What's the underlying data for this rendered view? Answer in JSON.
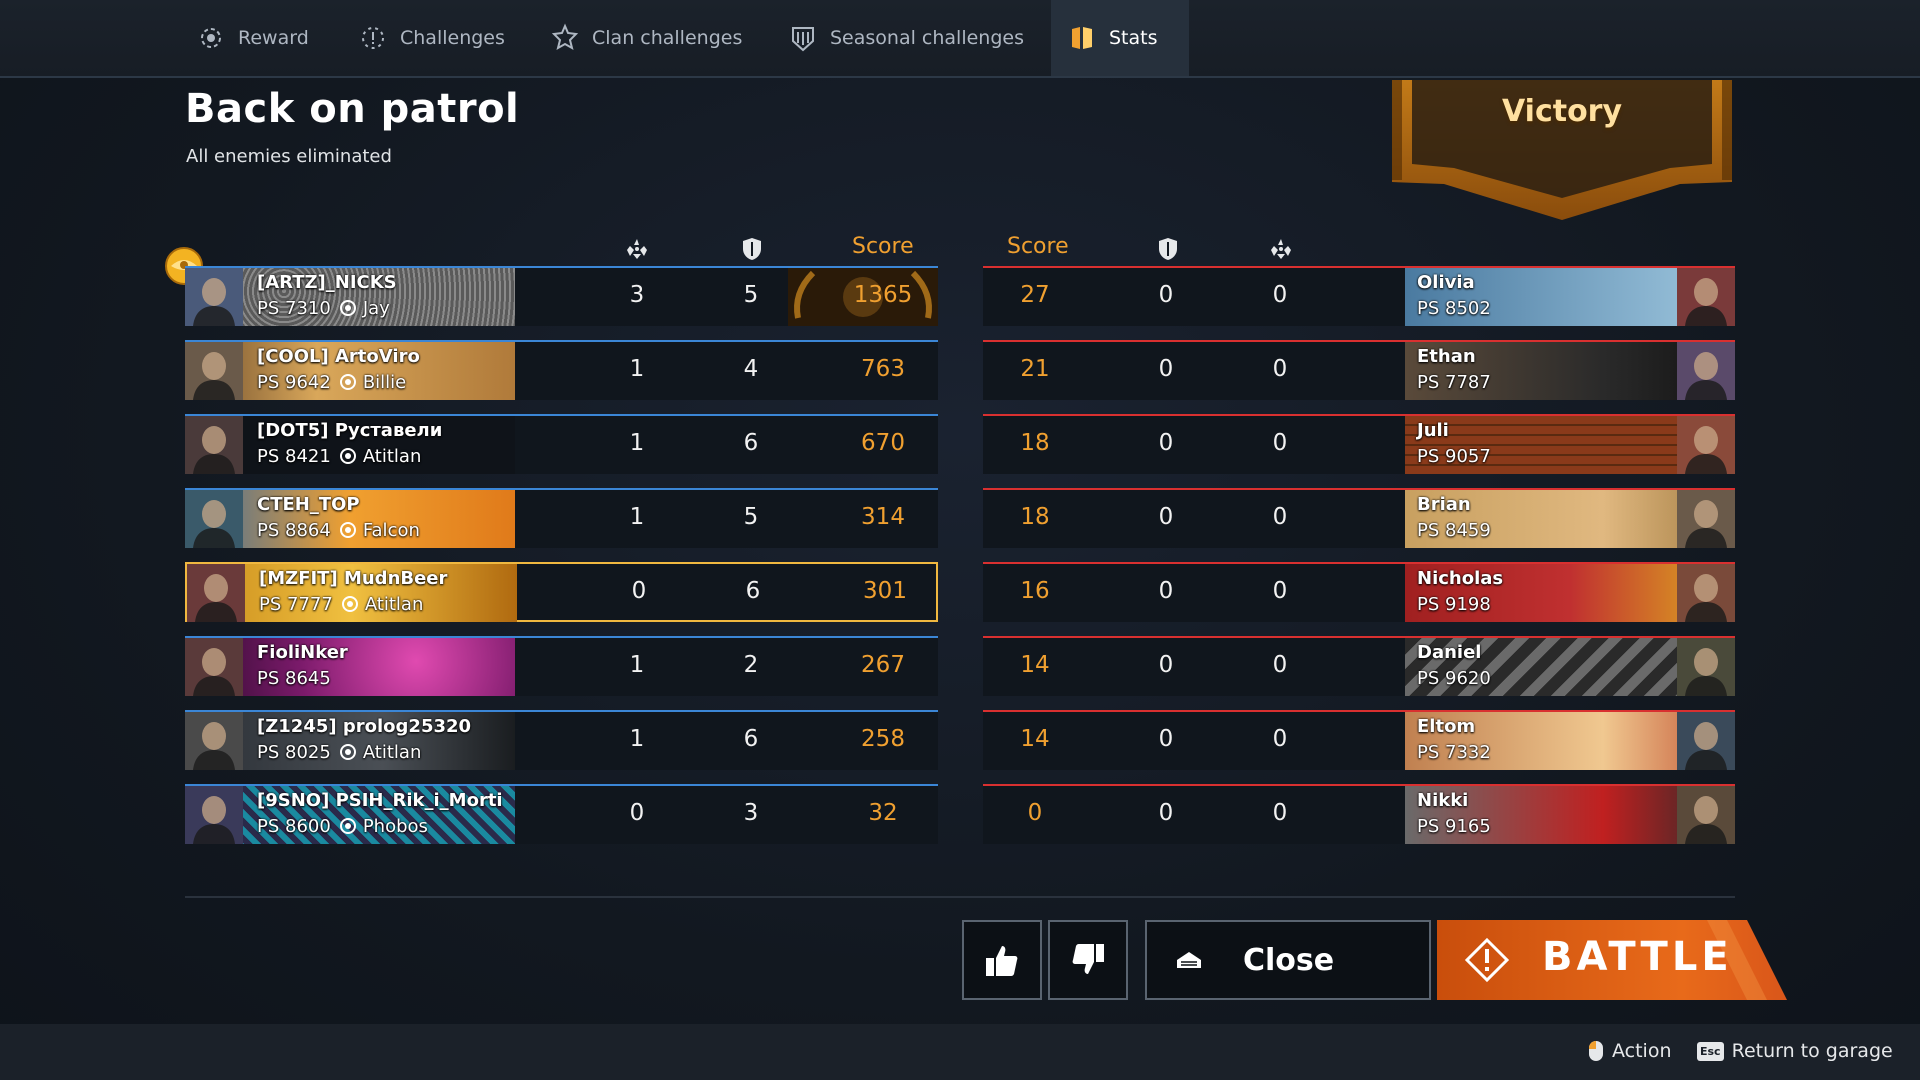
{
  "tabs": [
    {
      "label": "Reward",
      "icon": "reward-icon"
    },
    {
      "label": "Challenges",
      "icon": "challenges-icon"
    },
    {
      "label": "Clan challenges",
      "icon": "clan-challenges-icon"
    },
    {
      "label": "Seasonal challenges",
      "icon": "seasonal-challenges-icon"
    },
    {
      "label": "Stats",
      "icon": "stats-icon",
      "active": true
    }
  ],
  "header": {
    "title": "Back on patrol",
    "subtitle": "All enemies eliminated",
    "result": "Victory"
  },
  "columns": {
    "score_left": "Score",
    "score_right": "Score"
  },
  "team_left": [
    {
      "name": "[ARTZ]_NICKS",
      "ps": "PS 7310",
      "clan_icon": "crosshair-icon",
      "clan": "Jay",
      "kills": "3",
      "assists": "5",
      "score": "1365",
      "top": true
    },
    {
      "name": "[COOL] ArtoViro",
      "ps": "PS 9642",
      "clan_icon": "grid-badge-icon",
      "clan": "Billie",
      "kills": "1",
      "assists": "4",
      "score": "763"
    },
    {
      "name": "[DOT5] Руставели",
      "ps": "PS 8421",
      "clan_icon": "gear-icon",
      "clan": "Atitlan",
      "kills": "1",
      "assists": "6",
      "score": "670"
    },
    {
      "name": "CTEH_TOP",
      "ps": "PS 8864",
      "clan_icon": "ring-icon",
      "clan": "Falcon",
      "kills": "1",
      "assists": "5",
      "score": "314"
    },
    {
      "name": "[MZFIT] MudnBeer",
      "ps": "PS 7777",
      "clan_icon": "gear-icon",
      "clan": "Atitlan",
      "kills": "0",
      "assists": "6",
      "score": "301",
      "me": true
    },
    {
      "name": "FioliNker",
      "ps": "PS 8645",
      "clan_icon": "",
      "clan": "",
      "kills": "1",
      "assists": "2",
      "score": "267"
    },
    {
      "name": "[Z1245] prolog25320",
      "ps": "PS 8025",
      "clan_icon": "gear-icon",
      "clan": "Atitlan",
      "kills": "1",
      "assists": "6",
      "score": "258"
    },
    {
      "name": "[9SNO] PSIH_Rik_i_Morti",
      "ps": "PS 8600",
      "clan_icon": "mask-icon",
      "clan": "Phobos",
      "kills": "0",
      "assists": "3",
      "score": "32"
    }
  ],
  "team_right": [
    {
      "name": "Olivia",
      "ps": "PS 8502",
      "score": "27",
      "assists": "0",
      "kills": "0"
    },
    {
      "name": "Ethan",
      "ps": "PS 7787",
      "score": "21",
      "assists": "0",
      "kills": "0"
    },
    {
      "name": "Juli",
      "ps": "PS 9057",
      "score": "18",
      "assists": "0",
      "kills": "0"
    },
    {
      "name": "Brian",
      "ps": "PS 8459",
      "score": "18",
      "assists": "0",
      "kills": "0"
    },
    {
      "name": "Nicholas",
      "ps": "PS 9198",
      "score": "16",
      "assists": "0",
      "kills": "0"
    },
    {
      "name": "Daniel",
      "ps": "PS 9620",
      "score": "14",
      "assists": "0",
      "kills": "0"
    },
    {
      "name": "Eltom",
      "ps": "PS 7332",
      "score": "14",
      "assists": "0",
      "kills": "0"
    },
    {
      "name": "Nikki",
      "ps": "PS 9165",
      "score": "0",
      "assists": "0",
      "kills": "0"
    }
  ],
  "actions": {
    "close_label": "Close",
    "battle_label": "BATTLE"
  },
  "footer": {
    "action_label": "Action",
    "return_key": "Esc",
    "return_label": "Return to garage"
  },
  "colors": {
    "accent": "#f0a030",
    "team_left": "#3b86d6",
    "team_right": "#d93030",
    "battle": "#e86a1a"
  }
}
